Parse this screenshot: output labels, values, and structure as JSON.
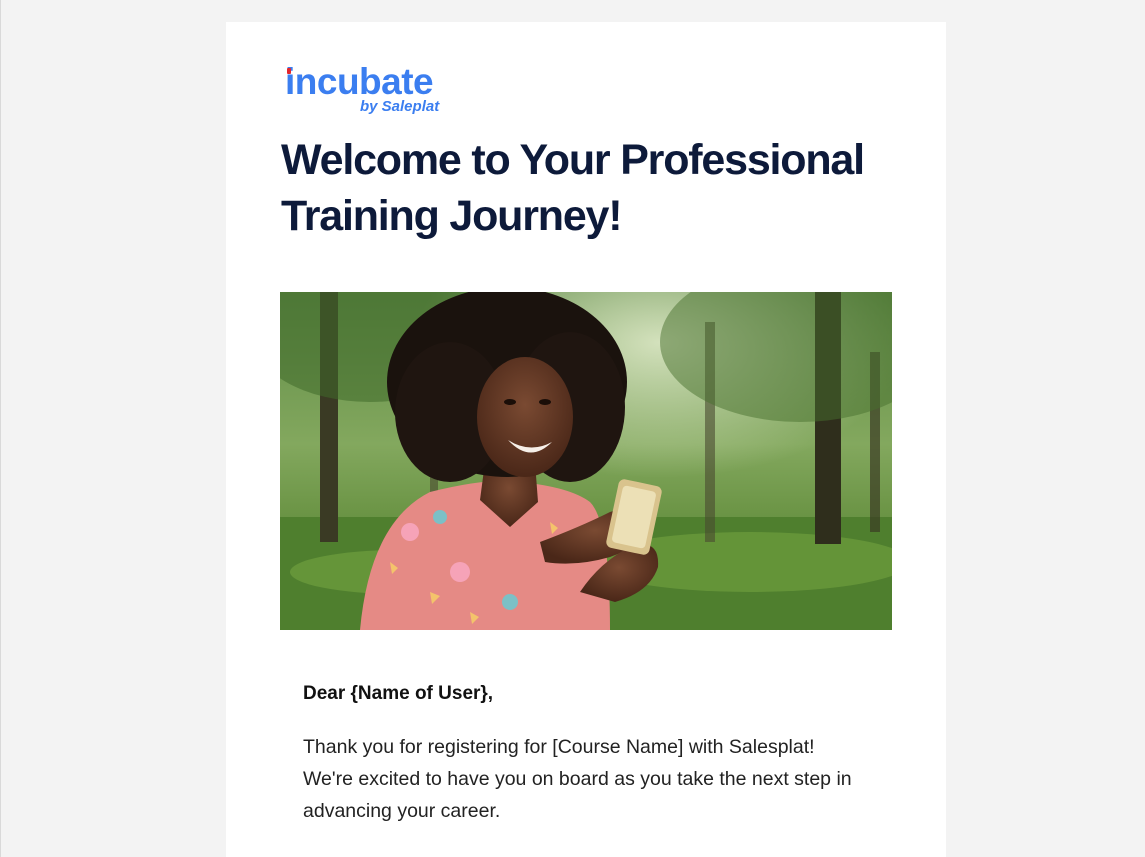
{
  "logo": {
    "brand": "incubate",
    "sub": "by Saleplat"
  },
  "headline": "Welcome to Your Professional Training Journey!",
  "hero_image": {
    "alt": "Smiling woman looking at her smartphone in a park"
  },
  "greeting": "Dear {Name of User},",
  "body": "Thank you for registering for [Course Name] with Salesplat! We're excited to have you on board as you take the next step in advancing your career.",
  "colors": {
    "brand_blue": "#3b7ef0",
    "brand_red": "#e3262d",
    "headline_navy": "#0d1a3a",
    "page_bg": "#f3f3f3",
    "card_bg": "#ffffff"
  }
}
